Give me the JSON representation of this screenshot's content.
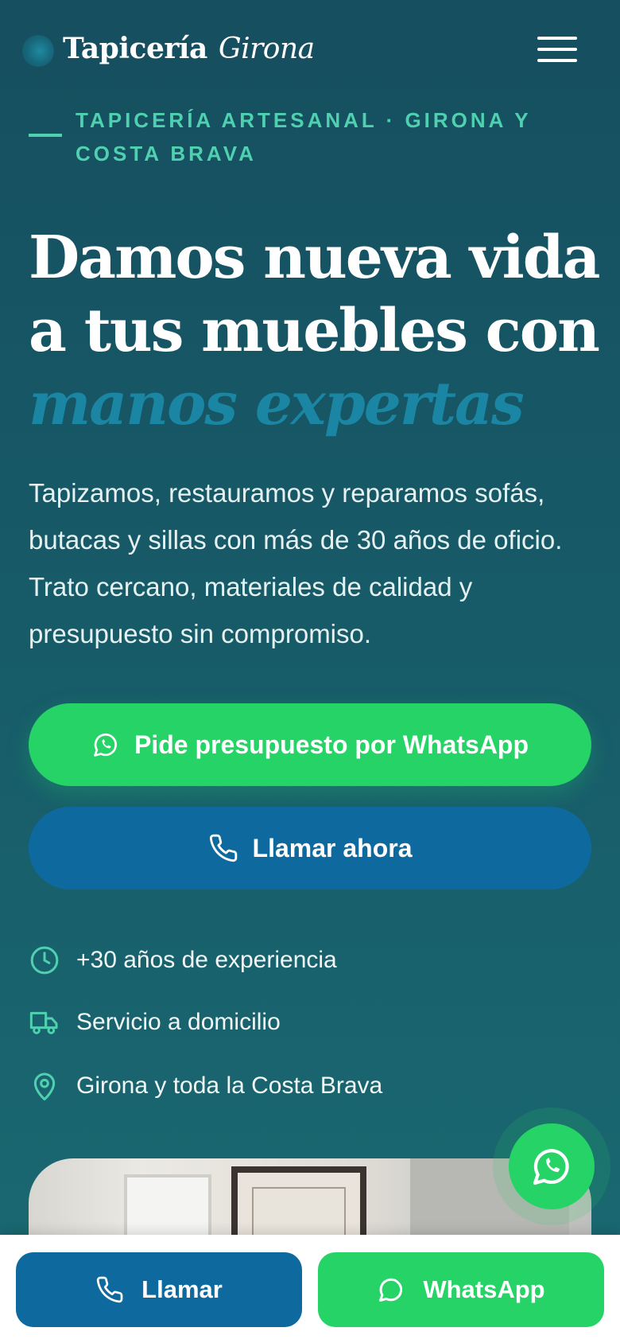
{
  "brand": {
    "name": "Tapicería",
    "name_accent": "Girona"
  },
  "eyebrow": "TAPICERÍA ARTESANAL · GIRONA Y COSTA BRAVA",
  "hero": {
    "headline": "Damos nueva vida a tus muebles con",
    "headline_accent": "manos expertas",
    "lead": "Tapizamos, restauramos y reparamos sofás, butacas y sillas con más de 30 años de oficio. Trato cercano, materiales de calidad y presupuesto sin compromiso."
  },
  "cta": {
    "whatsapp_label": "Pide presupuesto por WhatsApp",
    "call_label": "Llamar ahora"
  },
  "features": [
    {
      "icon": "clock-icon",
      "label": "+30 años de experiencia"
    },
    {
      "icon": "truck-icon",
      "label": "Servicio a domicilio"
    },
    {
      "icon": "map-pin-icon",
      "label": "Girona y toda la Costa Brava"
    }
  ],
  "bottom_bar": {
    "call_label": "Llamar",
    "whatsapp_label": "WhatsApp"
  },
  "colors": {
    "background": "#175a68",
    "accent_teal": "#4fd1b0",
    "accent_blue": "#1a86a4",
    "whatsapp_green": "#25d366",
    "call_blue": "#0e6a9e"
  }
}
